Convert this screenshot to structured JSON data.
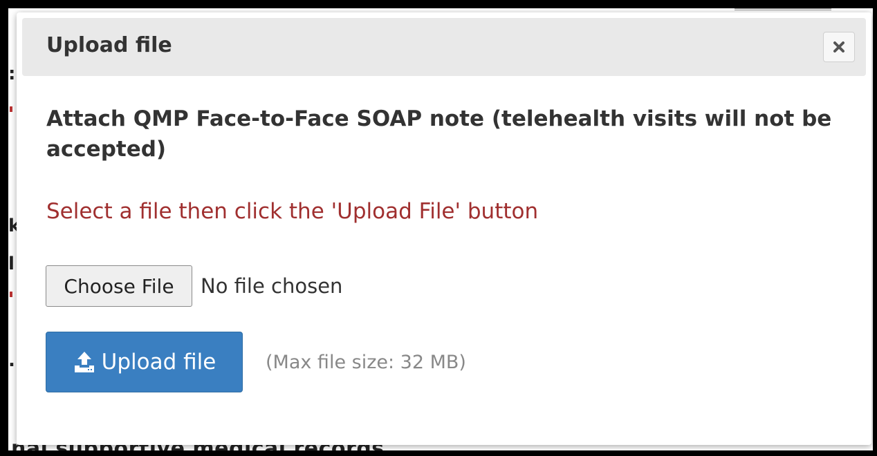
{
  "modal": {
    "title": "Upload file",
    "close_icon": "close-icon",
    "instruction": "Attach QMP Face-to-Face SOAP note (telehealth visits will not be accepted)",
    "hint": "Select a file then click the 'Upload File' button",
    "file_input": {
      "button_label": "Choose File",
      "status": "No file chosen"
    },
    "upload_button": {
      "label": "Upload file",
      "icon": "upload-icon",
      "color": "#3a7fc1"
    },
    "max_size": "(Max file size: 32 MB)"
  },
  "background": {
    "partial_text": "nal supportive medical records"
  },
  "colors": {
    "hint": "#a02f2f",
    "header_bg": "#e9e9e9"
  }
}
